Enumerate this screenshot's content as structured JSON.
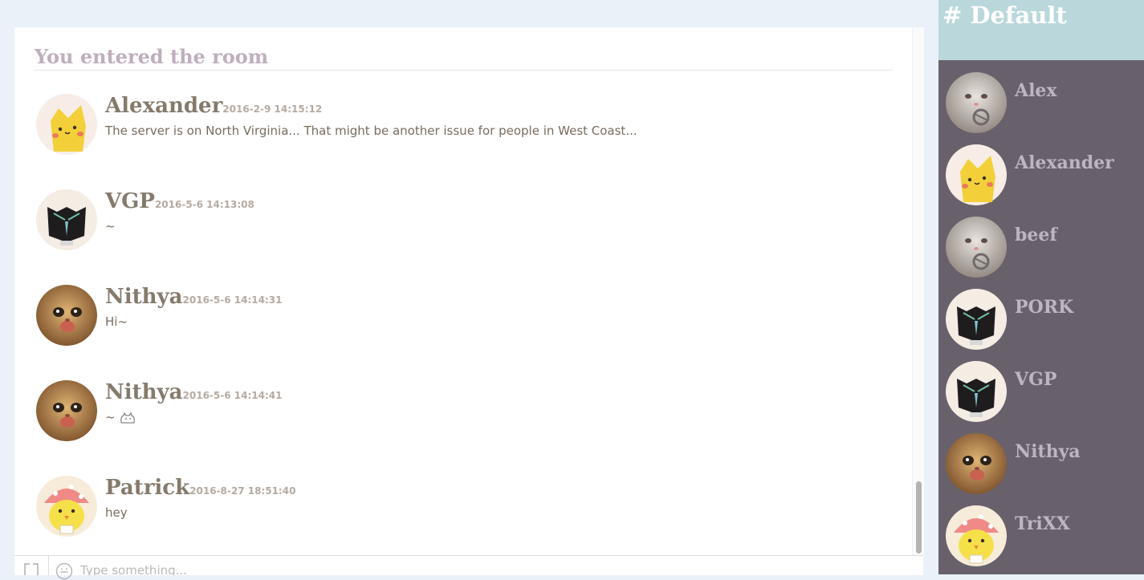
{
  "room": {
    "banner": "You entered the room"
  },
  "messages": [
    {
      "name": "Alexander",
      "time": "2016-2-9 14:15:12",
      "text": "The server is on North Virginia... That might be another issue for people in West Coast...",
      "avatar": "yellow-cat-avatar"
    },
    {
      "name": "VGP",
      "time": "2016-5-6 14:13:08",
      "text": "~",
      "avatar": "black-cat-avatar"
    },
    {
      "name": "Nithya",
      "time": "2016-5-6 14:14:31",
      "text": "Hi~",
      "avatar": "kitten-photo-avatar"
    },
    {
      "name": "Nithya",
      "time": "2016-5-6 14:14:41",
      "text": "~",
      "avatar": "kitten-photo-avatar",
      "has_cat_emoji": true
    },
    {
      "name": "Patrick",
      "time": "2016-8-27 18:51:40",
      "text": "hey",
      "avatar": "yellow-chick-avatar"
    }
  ],
  "composer": {
    "placeholder": "Type something..."
  },
  "sidebar": {
    "channel": "# Default",
    "users": [
      {
        "name": "Alex",
        "avatar": "white-cat-photo-avatar"
      },
      {
        "name": "Alexander",
        "avatar": "yellow-cat-avatar"
      },
      {
        "name": "beef",
        "avatar": "white-cat-photo-avatar"
      },
      {
        "name": "PORK",
        "avatar": "black-cat-avatar"
      },
      {
        "name": "VGP",
        "avatar": "black-cat-avatar"
      },
      {
        "name": "Nithya",
        "avatar": "kitten-photo-avatar"
      },
      {
        "name": "TriXX",
        "avatar": "yellow-chick-avatar"
      }
    ]
  },
  "colors": {
    "page_bg": "#eaf1f8",
    "sidebar_bg": "#68616b",
    "channel_header_bg": "#bad8dc",
    "name_color": "#857a6b",
    "banner_color": "#bfaebd"
  }
}
